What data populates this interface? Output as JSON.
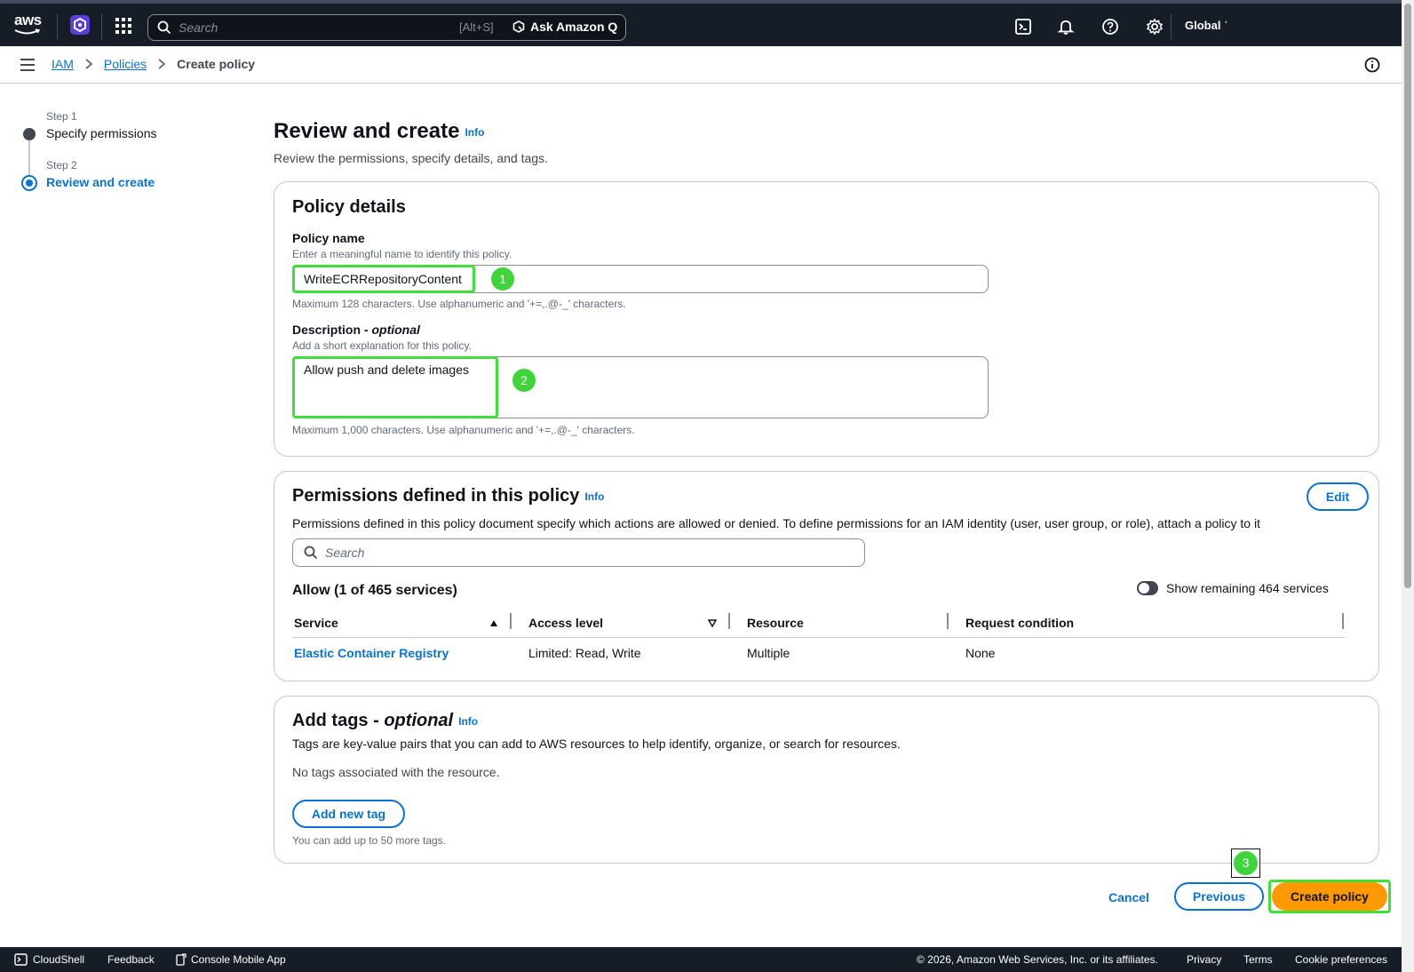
{
  "topnav": {
    "logo_text": "aws",
    "search_placeholder": "Search",
    "search_shortcut": "[Alt+S]",
    "ask_q_label": "Ask Amazon Q",
    "region": "Global"
  },
  "breadcrumb": {
    "items": [
      "IAM",
      "Policies"
    ],
    "current": "Create policy"
  },
  "steps": [
    {
      "small": "Step 1",
      "label": "Specify permissions"
    },
    {
      "small": "Step 2",
      "label": "Review and create"
    }
  ],
  "page": {
    "title": "Review and create",
    "info": "Info",
    "subtitle": "Review the permissions, specify details, and tags."
  },
  "policy_details": {
    "heading": "Policy details",
    "name_label": "Policy name",
    "name_hint": "Enter a meaningful name to identify this policy.",
    "name_value": "WriteECRRepositoryContent",
    "name_constraint": "Maximum 128 characters. Use alphanumeric and '+=,.@-_' characters.",
    "desc_label": "Description - ",
    "desc_optional": "optional",
    "desc_hint": "Add a short explanation for this policy.",
    "desc_value": "Allow push and delete images",
    "desc_constraint": "Maximum 1,000 characters. Use alphanumeric and '+=,.@-_' characters."
  },
  "permissions": {
    "heading": "Permissions defined in this policy",
    "info": "Info",
    "edit_label": "Edit",
    "description": "Permissions defined in this policy document specify which actions are allowed or denied. To define permissions for an IAM identity (user, user group, or role), attach a policy to it",
    "search_placeholder": "Search",
    "allow_label": "Allow (1 of 465 services)",
    "toggle_label": "Show remaining 464 services",
    "columns": [
      "Service",
      "Access level",
      "Resource",
      "Request condition"
    ],
    "rows": [
      {
        "service": "Elastic Container Registry",
        "access": "Limited: Read, Write",
        "resource": "Multiple",
        "condition": "None"
      }
    ]
  },
  "tags": {
    "heading": "Add tags - ",
    "optional": "optional",
    "info": "Info",
    "description": "Tags are key-value pairs that you can add to AWS resources to help identify, organize, or search for resources.",
    "empty": "No tags associated with the resource.",
    "add_label": "Add new tag",
    "limit": "You can add up to 50 more tags."
  },
  "actions": {
    "cancel": "Cancel",
    "previous": "Previous",
    "create": "Create policy"
  },
  "annotations": [
    "1",
    "2",
    "3"
  ],
  "bottombar": {
    "cloudshell": "CloudShell",
    "feedback": "Feedback",
    "mobile": "Console Mobile App",
    "copyright": "© 2026, Amazon Web Services, Inc. or its affiliates.",
    "privacy": "Privacy",
    "terms": "Terms",
    "cookies": "Cookie preferences"
  },
  "colors": {
    "nav_bg": "#161d26",
    "link": "#0972d3",
    "primary_button": "#ff9900",
    "highlight": "#3fe03a"
  }
}
